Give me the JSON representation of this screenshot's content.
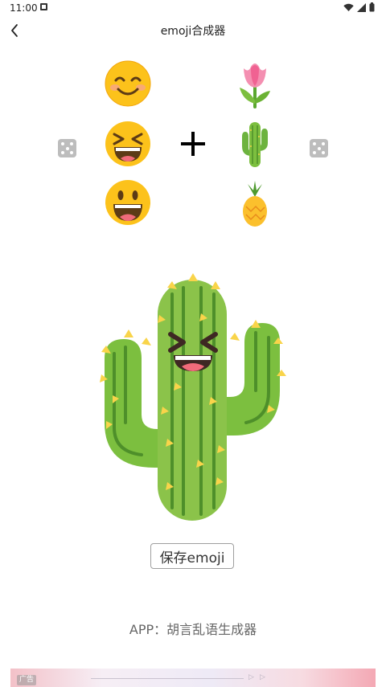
{
  "status_bar": {
    "time": "11:00",
    "icons": [
      "notification-icon",
      "wifi-icon",
      "signal-icon",
      "battery-icon"
    ]
  },
  "header": {
    "back_icon": "chevron-left-icon",
    "title": "emoji合成器"
  },
  "left_column": {
    "emojis": [
      "smiling-face-with-blush",
      "grinning-squinting-face",
      "grinning-face-big-eyes"
    ],
    "selected_index": 1
  },
  "right_column": {
    "emojis": [
      "tulip",
      "cactus",
      "pineapple"
    ],
    "selected_index": 1
  },
  "operator_icon": "plus-icon",
  "randomize_icon": "dice-icon",
  "result": {
    "emoji": "grinning-squinting-cactus"
  },
  "save_button": {
    "label": "保存emoji"
  },
  "footer": {
    "credit": "APP：胡言乱语生成器"
  },
  "ad": {
    "badge": "广告"
  }
}
